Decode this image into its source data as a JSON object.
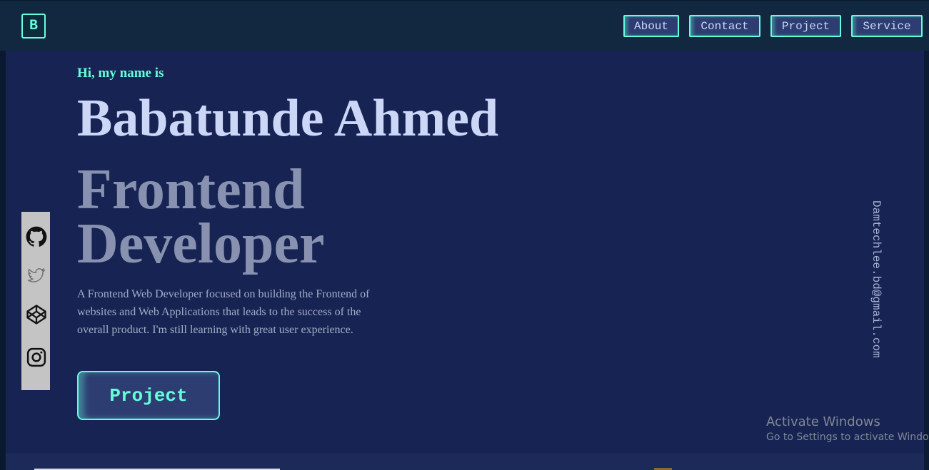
{
  "nav": {
    "logo_letter": "B",
    "items": [
      {
        "label": "About"
      },
      {
        "label": "Contact"
      },
      {
        "label": "Project"
      },
      {
        "label": "Service"
      }
    ]
  },
  "hero": {
    "greeting": "Hi, my name is",
    "name": "Babatunde Ahmed",
    "role_line1": "Frontend",
    "role_line2": "Developer",
    "description": "A Frontend Web Developer focused on building the Frontend of websites and Web Applications that leads to the success of the overall product. I'm still learning with great user experience.",
    "cta_label": "Project"
  },
  "social": {
    "icons": [
      "github-icon",
      "twitter-icon",
      "codepen-icon",
      "instagram-icon"
    ]
  },
  "email": "Damtechlee.bd@gmail.com",
  "watermark": {
    "title": "Activate Windows",
    "subtitle": "Go to Settings to activate Windows."
  },
  "colors": {
    "accent": "#64ffda",
    "hero_background": "#172453",
    "navbar_background": "#112840",
    "heading": "#ccd6f6",
    "subheading": "#8892b0"
  }
}
